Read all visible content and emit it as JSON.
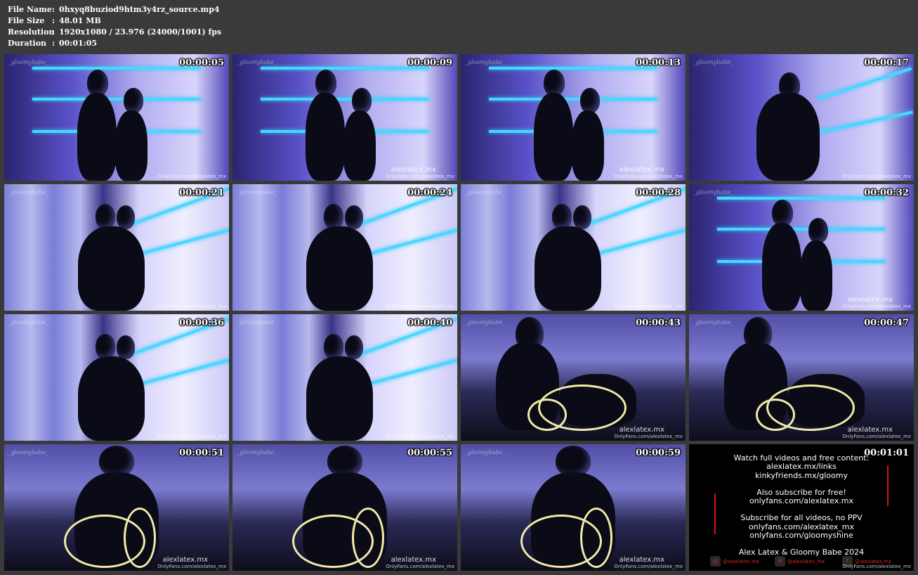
{
  "file_info": {
    "file_name_label": "File Name",
    "file_name": "0hxyq8buziod9htm3y4rz_source.mp4",
    "file_size_label": "File Size",
    "file_size": "48.01 MB",
    "resolution_label": "Resolution",
    "resolution": "1920x1080 / 23.976 (24000/1001) fps",
    "duration_label": "Duration",
    "duration": "00:01:05",
    "separator": ":"
  },
  "thumbnails": [
    {
      "time": "00:00:05",
      "scene": "wall",
      "watermark": "OnlyFans.com/alexlatex_mx",
      "signature": "_gloomybabe_"
    },
    {
      "time": "00:00:09",
      "scene": "wall",
      "watermark": "OnlyFans.com/alexlatex_mx",
      "watermark_big": "alexlatex.mx",
      "signature": "_gloomybabe_"
    },
    {
      "time": "00:00:13",
      "scene": "wall",
      "watermark": "OnlyFans.com/alexlatex_mx",
      "watermark_big": "alexlatex.mx",
      "signature": "_gloomybabe_"
    },
    {
      "time": "00:00:17",
      "scene": "wall-angled",
      "watermark": "OnlyFans.com/alexlatex_mx",
      "signature": "_gloomybabe_"
    },
    {
      "time": "00:00:21",
      "scene": "curtain",
      "watermark": "OnlyFans.com/alexlatex_mx",
      "signature": "_gloomybabe_"
    },
    {
      "time": "00:00:24",
      "scene": "curtain",
      "watermark": "OnlyFans.com/alexlatex_mx",
      "signature": "_gloomybabe_"
    },
    {
      "time": "00:00:28",
      "scene": "curtain",
      "watermark": "OnlyFans.com/alexlatex_mx",
      "signature": "_gloomybabe_"
    },
    {
      "time": "00:00:32",
      "scene": "wall",
      "watermark": "OnlyFans.com/alexlatex_mx",
      "watermark_big": "alexlatex.mx",
      "signature": "_gloomybabe_"
    },
    {
      "time": "00:00:36",
      "scene": "curtain",
      "watermark": "OnlyFans.com/alexlatex_mx",
      "signature": "_gloomybabe_"
    },
    {
      "time": "00:00:40",
      "scene": "curtain",
      "watermark": "OnlyFans.com/alexlatex_mx",
      "signature": "_gloomybabe_"
    },
    {
      "time": "00:00:43",
      "scene": "bed-rope",
      "watermark": "OnlyFans.com/alexlatex_mx",
      "watermark_big": "alexlatex.mx",
      "signature": "_gloomybabe_"
    },
    {
      "time": "00:00:47",
      "scene": "bed-rope",
      "watermark": "OnlyFans.com/alexlatex_mx",
      "watermark_big": "alexlatex.mx",
      "signature": "_gloomybabe_"
    },
    {
      "time": "00:00:51",
      "scene": "kneel-rope",
      "watermark": "OnlyFans.com/alexlatex_mx",
      "watermark_big": "alexlatex.mx",
      "signature": "_gloomybabe_"
    },
    {
      "time": "00:00:55",
      "scene": "kneel-rope",
      "watermark": "OnlyFans.com/alexlatex_mx",
      "watermark_big": "alexlatex.mx",
      "signature": "_gloomybabe_"
    },
    {
      "time": "00:00:59",
      "scene": "kneel-rope",
      "watermark": "OnlyFans.com/alexlatex_mx",
      "watermark_big": "alexlatex.mx",
      "signature": "_gloomybabe_"
    }
  ],
  "promo": {
    "time": "00:01:01",
    "lines_a": [
      "Watch full videos and free content:",
      "alexlatex.mx/links",
      "kinkyfriends.mx/gloomy"
    ],
    "lines_b": [
      "Also subscribe for free!",
      "onlyfans.com/alexlatex.mx"
    ],
    "lines_c": [
      "Subscribe for all videos, no PPV",
      "onlyfans.com/alexlatex_mx",
      "onlyfans.com/gloomyshine"
    ],
    "lines_d": [
      "Alex Latex & Gloomy Babe 2024"
    ],
    "socials": [
      {
        "icon": "instagram-icon",
        "glyph": "◎",
        "handle": "@alexlatex.mx"
      },
      {
        "icon": "x-icon",
        "glyph": "✕",
        "handle": "@alexlatex_mx"
      },
      {
        "icon": "facebook-icon",
        "glyph": "f",
        "handle": "@alexlatex.mx"
      }
    ],
    "watermark": "OnlyFans.com/alexlatex_mx",
    "accent_color": "#d41414"
  }
}
